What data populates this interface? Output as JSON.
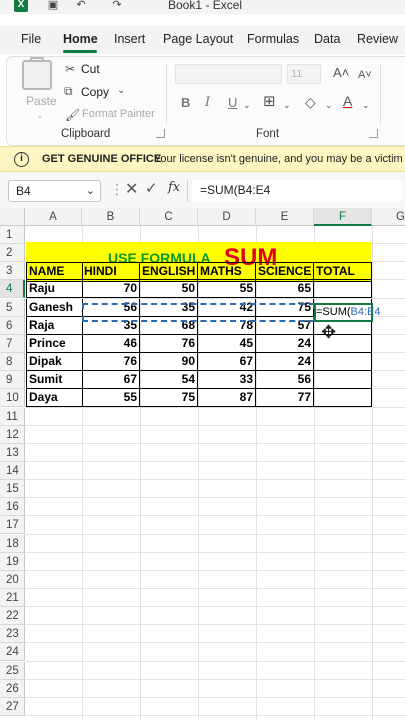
{
  "title_bar": {
    "title": "Book1 - Excel",
    "logo": "X"
  },
  "ribbon_tabs": [
    "File",
    "Home",
    "Insert",
    "Page Layout",
    "Formulas",
    "Data",
    "Review"
  ],
  "active_tab": "Home",
  "clipboard": {
    "paste_label": "Paste",
    "cut_label": "Cut",
    "copy_label": "Copy",
    "format_painter_label": "Format Painter",
    "group_label": "Clipboard"
  },
  "font_group": {
    "size_placeholder": "11",
    "bold": "B",
    "italic": "I",
    "underline": "U",
    "group_label": "Font"
  },
  "banner": {
    "title": "GET GENUINE OFFICE",
    "message": "Your license isn't genuine, and you may be a victim o"
  },
  "formula_bar": {
    "name_box": "B4",
    "formula": "=SUM(B4:E4"
  },
  "columns": [
    "A",
    "B",
    "C",
    "D",
    "E",
    "F",
    "G"
  ],
  "selected_column": "F",
  "rows": [
    "1",
    "2",
    "3",
    "4",
    "5",
    "6",
    "7",
    "8",
    "9",
    "10",
    "11",
    "12",
    "13",
    "14",
    "15",
    "16",
    "17",
    "18",
    "19",
    "20",
    "21",
    "22",
    "23",
    "24",
    "25",
    "26",
    "27"
  ],
  "selected_row": "4",
  "sheet_title": {
    "part1": "USE FORMULA",
    "part2": "SUM"
  },
  "table": {
    "headers": [
      "NAME",
      "HINDI",
      "ENGLISH",
      "MATHS",
      "SCIENCE",
      "TOTAL"
    ],
    "records": [
      {
        "name": "Raju",
        "scores": [
          "70",
          "50",
          "55",
          "65"
        ]
      },
      {
        "name": "Ganesh",
        "scores": [
          "56",
          "35",
          "42",
          "75"
        ]
      },
      {
        "name": "Raja",
        "scores": [
          "35",
          "68",
          "78",
          "57"
        ]
      },
      {
        "name": "Prince",
        "scores": [
          "46",
          "76",
          "45",
          "24"
        ]
      },
      {
        "name": "Dipak",
        "scores": [
          "76",
          "90",
          "67",
          "24"
        ]
      },
      {
        "name": "Sumit",
        "scores": [
          "67",
          "54",
          "33",
          "56"
        ]
      },
      {
        "name": "Daya",
        "scores": [
          "55",
          "75",
          "87",
          "77"
        ]
      }
    ]
  },
  "editing_cell": {
    "prefix": "=SUM(",
    "reference": "B4:E4"
  },
  "icons": {
    "save": "save-icon",
    "undo": "undo-icon",
    "redo": "redo-icon",
    "cut": "scissors-icon",
    "copy": "copy-icon",
    "format_painter": "brush-icon",
    "info": "info-icon",
    "cancel": "close-icon",
    "enter": "check-icon",
    "function": "fx-icon",
    "cursor": "move-cursor-icon"
  },
  "colors": {
    "excel_green": "#107c41",
    "title_band": "#ffff00",
    "title_green": "#0a9a1f",
    "title_red": "#e0001a",
    "banner_bg": "#fdf6c3",
    "reference_blue": "#2b6cb0"
  }
}
